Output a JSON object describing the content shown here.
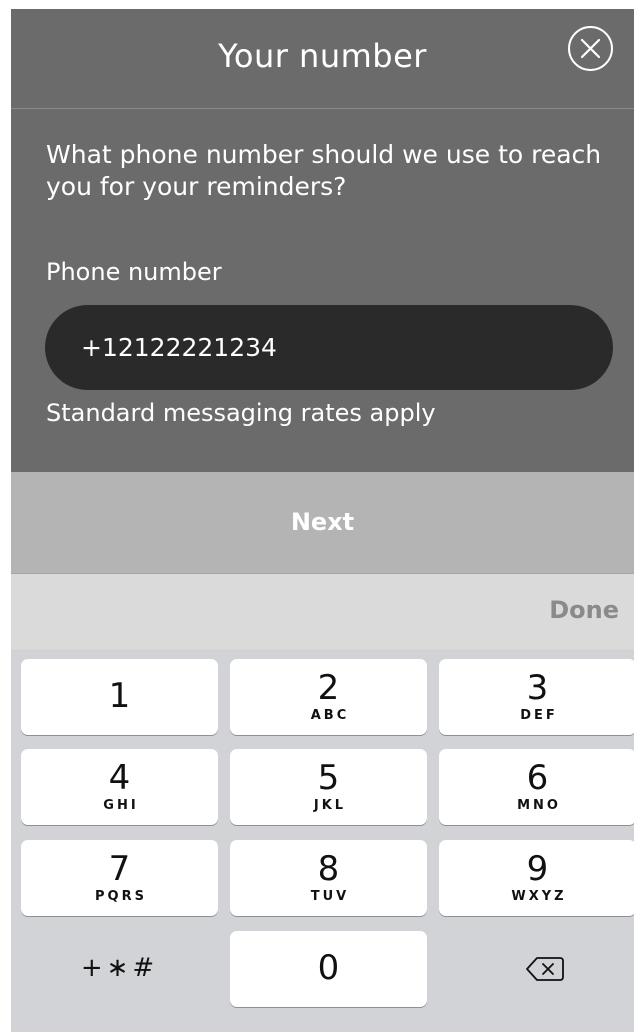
{
  "header": {
    "title": "Your number",
    "close_icon": "close-circle-icon"
  },
  "question": "What phone number should we use to reach you for your reminders?",
  "phone": {
    "label": "Phone number",
    "value": "+12122221234"
  },
  "rates_note": "Standard messaging rates apply",
  "next_label": "Next",
  "keyboard": {
    "done_label": "Done",
    "keys": [
      {
        "num": "1",
        "letters": ""
      },
      {
        "num": "2",
        "letters": "ABC"
      },
      {
        "num": "3",
        "letters": "DEF"
      },
      {
        "num": "4",
        "letters": "GHI"
      },
      {
        "num": "5",
        "letters": "JKL"
      },
      {
        "num": "6",
        "letters": "MNO"
      },
      {
        "num": "7",
        "letters": "PQRS"
      },
      {
        "num": "8",
        "letters": "TUV"
      },
      {
        "num": "9",
        "letters": "WXYZ"
      },
      {
        "num": "0",
        "letters": ""
      }
    ],
    "symbols_label": "+∗#",
    "delete_icon": "backspace-icon"
  },
  "colors": {
    "top_bg": "#6b6b6b",
    "input_bg": "#2a2a2a",
    "next_bg": "#b4b4b4",
    "keypad_bg": "#d1d3d7"
  }
}
